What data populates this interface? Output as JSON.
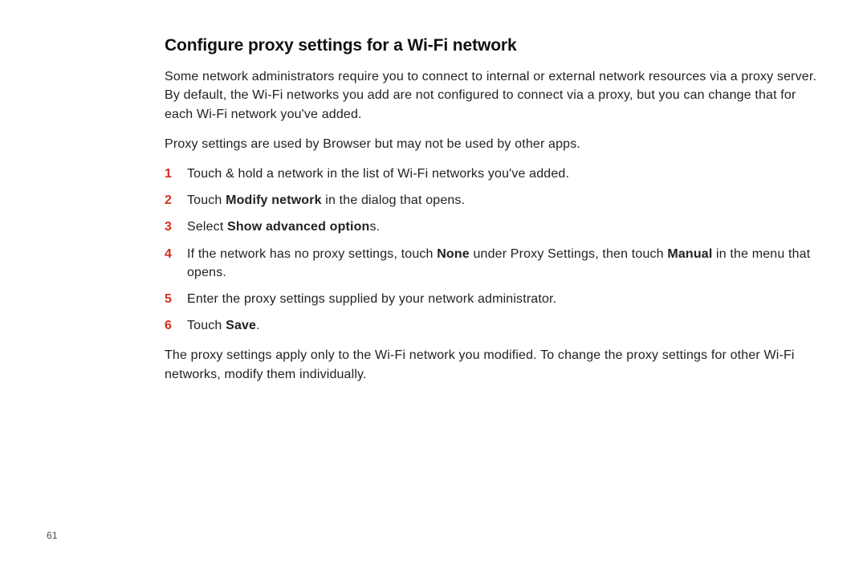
{
  "pageNumber": "61",
  "heading": "Configure proxy settings for a Wi-Fi network",
  "intro1": "Some network administrators require you to connect to internal or external network resources via a proxy server. By default, the Wi-Fi networks you add are not configured to connect via a proxy, but you can change that for each Wi-Fi network you've added.",
  "intro2": "Proxy settings are used by Browser but may not be used by other apps.",
  "steps": [
    {
      "n": "1",
      "parts": [
        {
          "t": "Touch & hold a network in the list of Wi-Fi networks you've added."
        }
      ]
    },
    {
      "n": "2",
      "parts": [
        {
          "t": "Touch "
        },
        {
          "t": "Modify network",
          "b": true
        },
        {
          "t": " in the dialog that opens."
        }
      ]
    },
    {
      "n": "3",
      "parts": [
        {
          "t": "Select "
        },
        {
          "t": "Show advanced option",
          "b": true
        },
        {
          "t": "s."
        }
      ]
    },
    {
      "n": "4",
      "parts": [
        {
          "t": "If the network has no proxy settings, touch "
        },
        {
          "t": "None",
          "b": true
        },
        {
          "t": " under Proxy Settings, then touch "
        },
        {
          "t": "Manual",
          "b": true
        },
        {
          "t": " in the menu that opens."
        }
      ]
    },
    {
      "n": "5",
      "parts": [
        {
          "t": "Enter the proxy settings supplied by your network administrator."
        }
      ]
    },
    {
      "n": "6",
      "parts": [
        {
          "t": "Touch "
        },
        {
          "t": "Save",
          "b": true
        },
        {
          "t": "."
        }
      ]
    }
  ],
  "outro": "The proxy settings apply only to the Wi-Fi network you modified. To change the proxy settings for other Wi-Fi networks, modify them individually."
}
